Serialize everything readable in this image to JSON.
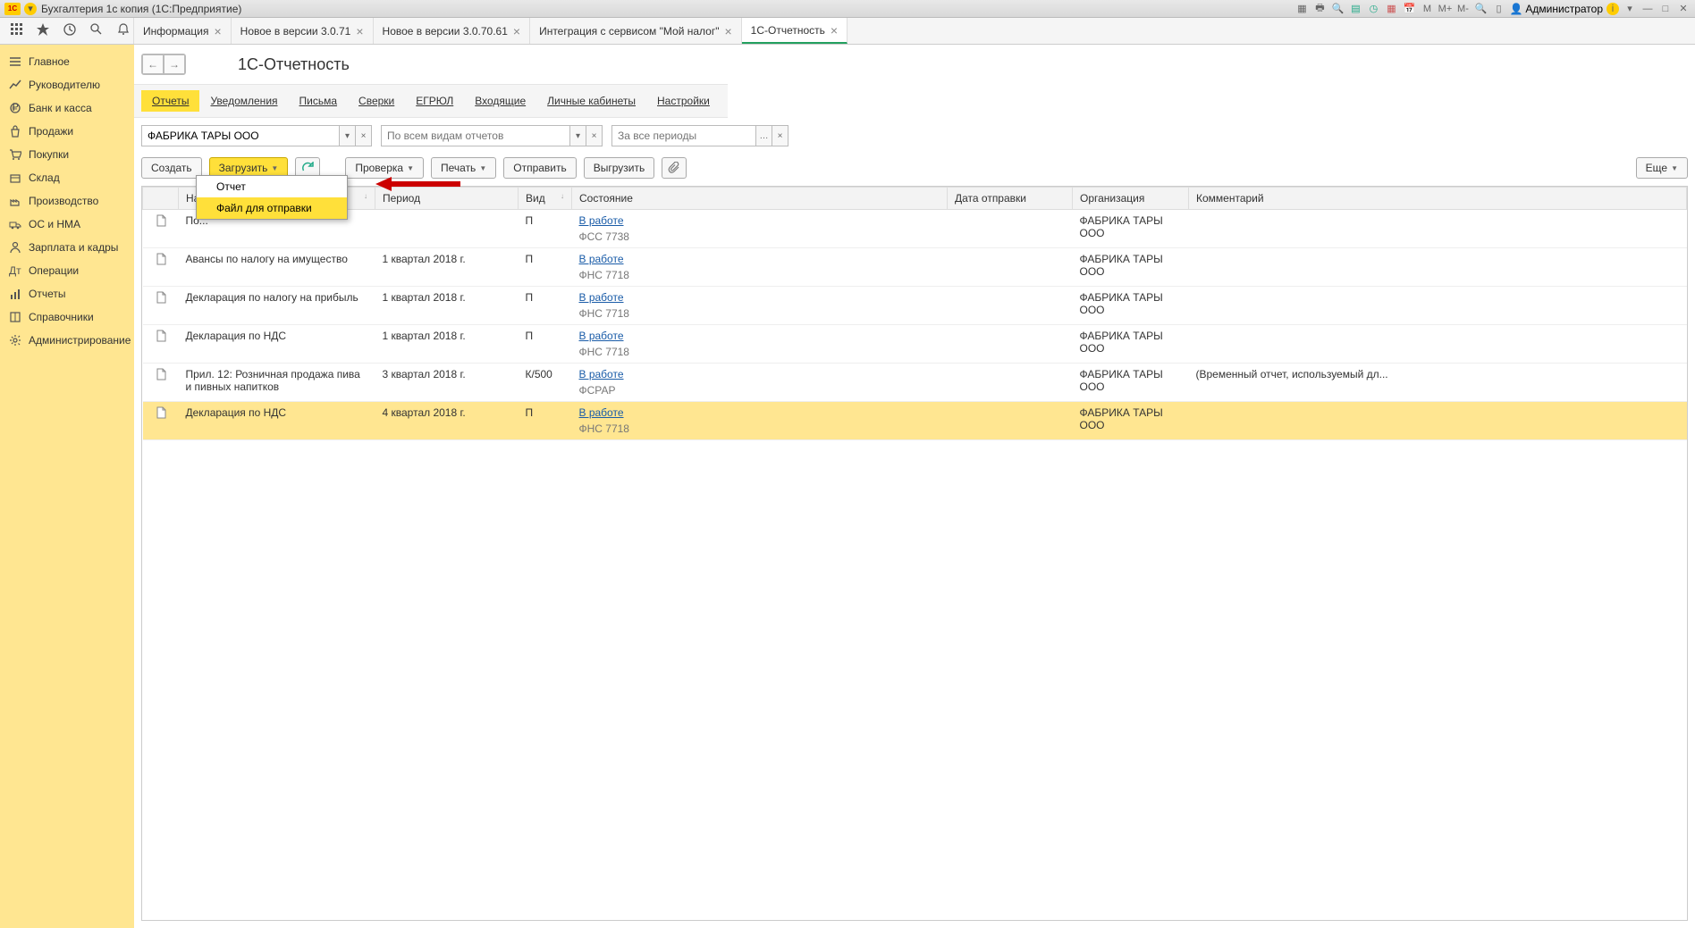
{
  "title": "Бухгалтерия 1с копия  (1С:Предприятие)",
  "user": "Администратор",
  "tabs": [
    {
      "label": "Информация"
    },
    {
      "label": "Новое в версии 3.0.71"
    },
    {
      "label": "Новое в версии 3.0.70.61"
    },
    {
      "label": "Интеграция с сервисом \"Мой налог\""
    },
    {
      "label": "1С-Отчетность",
      "active": true
    }
  ],
  "sidebar": [
    {
      "label": "Главное",
      "i": "menu"
    },
    {
      "label": "Руководителю",
      "i": "chart"
    },
    {
      "label": "Банк и касса",
      "i": "coin"
    },
    {
      "label": "Продажи",
      "i": "bag"
    },
    {
      "label": "Покупки",
      "i": "cart"
    },
    {
      "label": "Склад",
      "i": "box"
    },
    {
      "label": "Производство",
      "i": "factory"
    },
    {
      "label": "ОС и НМА",
      "i": "truck"
    },
    {
      "label": "Зарплата и кадры",
      "i": "person"
    },
    {
      "label": "Операции",
      "i": "ops"
    },
    {
      "label": "Отчеты",
      "i": "bars"
    },
    {
      "label": "Справочники",
      "i": "book"
    },
    {
      "label": "Администрирование",
      "i": "gear"
    }
  ],
  "page_title": "1С-Отчетность",
  "subtabs": [
    "Отчеты",
    "Уведомления",
    "Письма",
    "Сверки",
    "ЕГРЮЛ",
    "Входящие",
    "Личные кабинеты",
    "Настройки"
  ],
  "filters": {
    "org": "ФАБРИКА ТАРЫ ООО",
    "type_ph": "По всем видам отчетов",
    "period_ph": "За все периоды"
  },
  "toolbar": {
    "create": "Создать",
    "load": "Загрузить",
    "check": "Проверка",
    "print": "Печать",
    "send": "Отправить",
    "export": "Выгрузить",
    "more": "Еще"
  },
  "dropdown": {
    "i0": "Отчет",
    "i1": "Файл для отправки"
  },
  "cols": {
    "name": "Наименование",
    "period": "Период",
    "kind": "Вид",
    "status": "Состояние",
    "sent": "Дата отправки",
    "org": "Организация",
    "comment": "Комментарий"
  },
  "rows": [
    {
      "name": "По...",
      "period": "",
      "kind": "П",
      "status": "В работе",
      "sub": "ФСС 7738",
      "org": "ФАБРИКА ТАРЫ ООО",
      "comment": ""
    },
    {
      "name": "Авансы по налогу на имущество",
      "period": "1 квартал 2018 г.",
      "kind": "П",
      "status": "В работе",
      "sub": "ФНС 7718",
      "org": "ФАБРИКА ТАРЫ ООО",
      "comment": ""
    },
    {
      "name": "Декларация по налогу на прибыль",
      "period": "1 квартал 2018 г.",
      "kind": "П",
      "status": "В работе",
      "sub": "ФНС 7718",
      "org": "ФАБРИКА ТАРЫ ООО",
      "comment": ""
    },
    {
      "name": "Декларация по НДС",
      "period": "1 квартал 2018 г.",
      "kind": "П",
      "status": "В работе",
      "sub": "ФНС 7718",
      "org": "ФАБРИКА ТАРЫ ООО",
      "comment": ""
    },
    {
      "name": "Прил. 12: Розничная продажа пива и пивных напитков",
      "period": "3 квартал 2018 г.",
      "kind": "К/500",
      "status": "В работе",
      "sub": "ФСРАР",
      "org": "ФАБРИКА ТАРЫ ООО",
      "comment": "(Временный отчет, используемый дл..."
    },
    {
      "name": "Декларация по НДС",
      "period": "4 квартал 2018 г.",
      "kind": "П",
      "status": "В работе",
      "sub": "ФНС 7718",
      "org": "ФАБРИКА ТАРЫ ООО",
      "comment": "",
      "sel": true
    }
  ],
  "tb_m": "M",
  "tb_mp": "M+",
  "tb_mm": "M-"
}
